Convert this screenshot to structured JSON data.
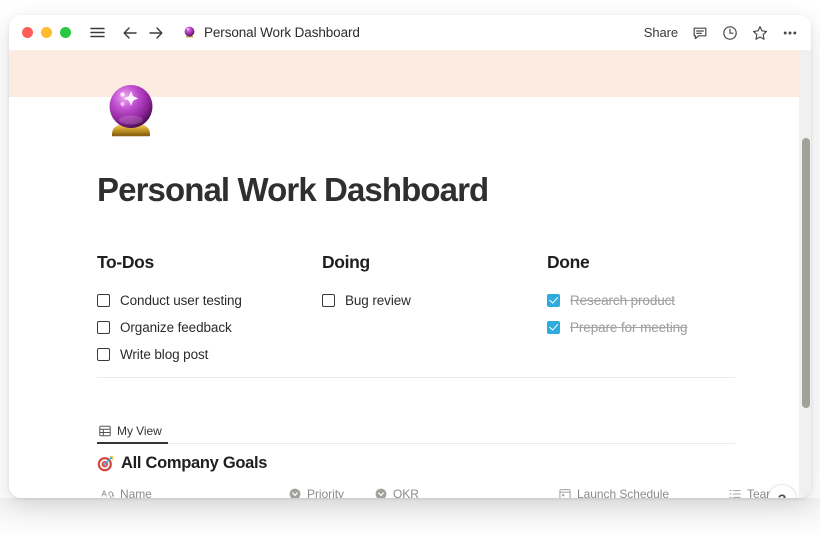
{
  "window": {
    "titlebar": {
      "traffic_lights": [
        {
          "name": "close",
          "color": "#FF5F57"
        },
        {
          "name": "minimize",
          "color": "#FEBC2E"
        },
        {
          "name": "maximize",
          "color": "#28C840"
        }
      ],
      "menu_icon": "hamburger-menu-icon",
      "back_icon": "arrow-left-icon",
      "forward_icon": "arrow-right-icon",
      "page_emoji": "crystal-ball",
      "title": "Personal Work Dashboard",
      "share_label": "Share",
      "comment_icon": "comment-icon",
      "history_icon": "clock-icon",
      "favorite_icon": "star-icon",
      "more_icon": "ellipsis-icon"
    },
    "banner": {
      "color": "#FCEBE0"
    },
    "scrollbar": {
      "track_color": "#f1f0ee",
      "thumb_color": "#a1a099"
    },
    "help_button_label": "?"
  },
  "page": {
    "icon_emoji": "crystal-ball",
    "title": "Personal Work Dashboard",
    "columns": [
      {
        "heading": "To-Dos",
        "tasks": [
          {
            "label": "Conduct user testing",
            "checked": false
          },
          {
            "label": "Organize feedback",
            "checked": false
          },
          {
            "label": "Write blog post",
            "checked": false
          }
        ]
      },
      {
        "heading": "Doing",
        "tasks": [
          {
            "label": "Bug review",
            "checked": false
          }
        ]
      },
      {
        "heading": "Done",
        "tasks": [
          {
            "label": "Research product",
            "checked": true
          },
          {
            "label": "Prepare for meeting",
            "checked": true
          }
        ]
      }
    ],
    "database": {
      "tab": {
        "label": "My View",
        "icon": "table-grid-icon"
      },
      "emoji": "dart-target",
      "title": "All Company Goals",
      "columns": [
        {
          "label": "Name",
          "icon": "text-aa-icon"
        },
        {
          "label": "Priority",
          "icon": "select-chevron-icon"
        },
        {
          "label": "OKR",
          "icon": "select-chevron-icon"
        },
        {
          "label": "Launch Schedule",
          "icon": "calendar-icon"
        },
        {
          "label": "Team",
          "icon": "multi-select-list-icon"
        }
      ]
    }
  },
  "background": {
    "ghost_text": "clipped text from window behind"
  },
  "colors": {
    "accent_checkbox": "#2EAADC",
    "banner": "#FCEBE0",
    "text_primary": "#211f1e",
    "text_muted": "#8d8b87"
  }
}
